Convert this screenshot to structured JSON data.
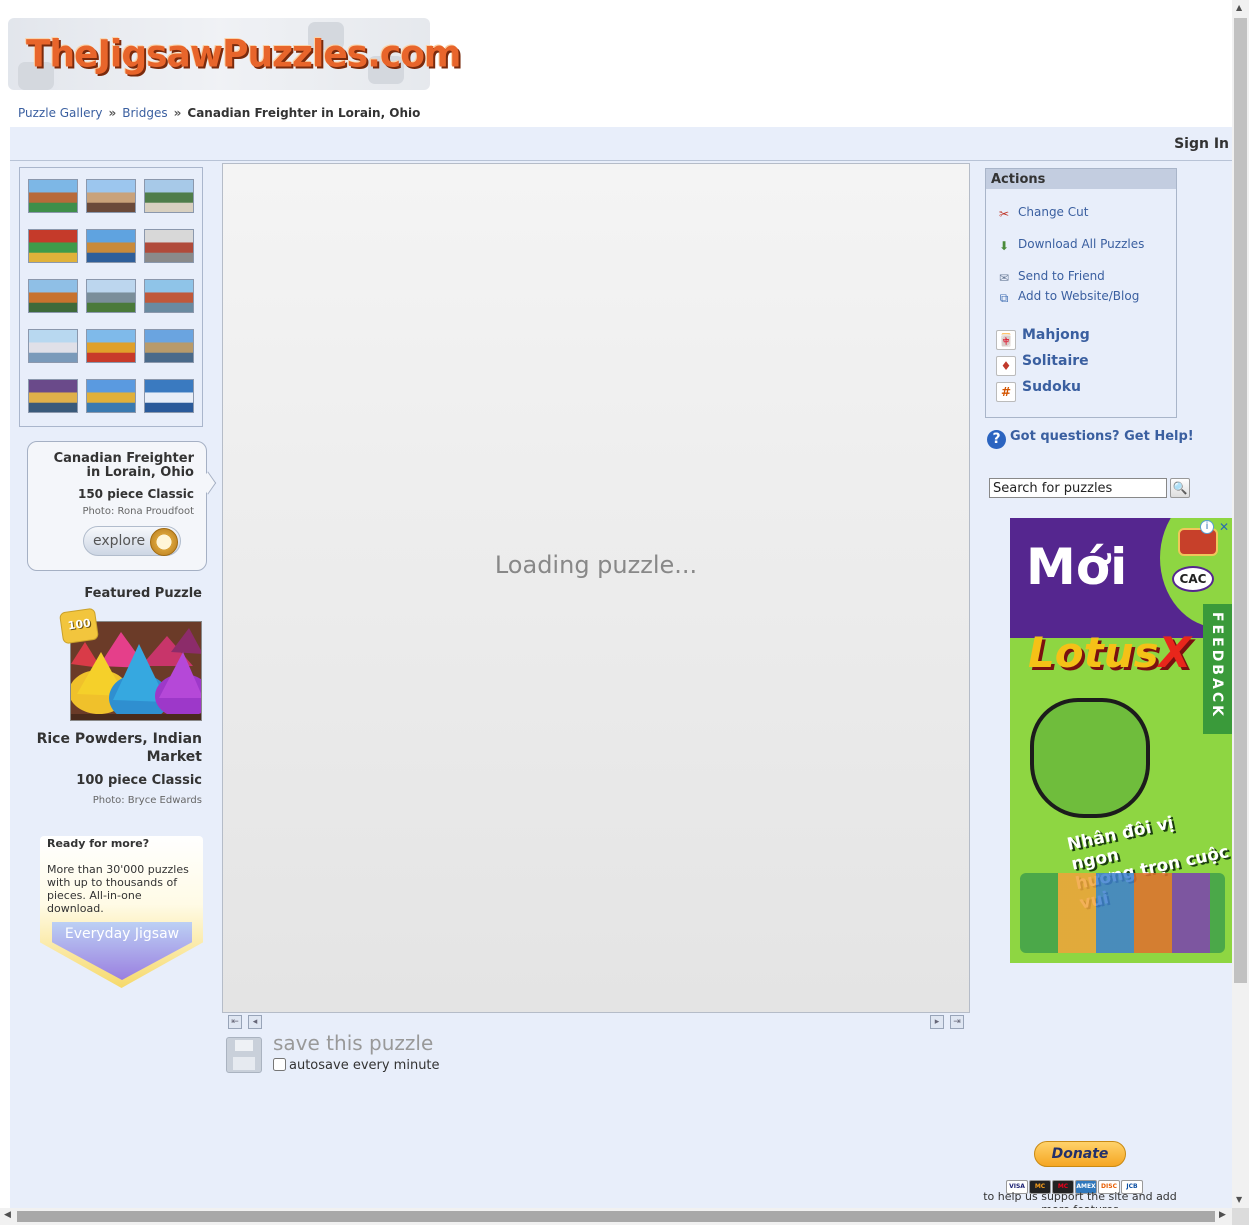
{
  "logo": {
    "text": "TheJigsawPuzzles.com"
  },
  "breadcrumb": {
    "items": [
      "Puzzle Gallery",
      "Bridges"
    ],
    "separator": "»",
    "current": "Canadian Freighter in Lorain, Ohio"
  },
  "header": {
    "sign_in": "Sign In"
  },
  "thumbnails": {
    "count": 15
  },
  "puzzle_info": {
    "title": "Canadian Freighter in Lorain, Ohio",
    "pieces": "150 piece Classic",
    "credit": "Photo: Rona Proudfoot",
    "explore_label": "explore"
  },
  "featured": {
    "heading": "Featured Puzzle",
    "badge": "100",
    "title": "Rice Powders, Indian Market",
    "pieces": "100 piece Classic",
    "credit": "Photo: Bryce Edwards"
  },
  "promo": {
    "heading": "Ready for more?",
    "body": "More than 30'000 puzzles with up to thousands of pieces. All-in-one download.",
    "button": "Everyday Jigsaw"
  },
  "puzzle_area": {
    "loading": "Loading puzzle...",
    "save_label": "save this puzzle",
    "autosave_label": "autosave every minute"
  },
  "actions": {
    "heading": "Actions",
    "items": [
      {
        "label": "Change Cut",
        "icon": "scissors-icon"
      },
      {
        "label": "Download All Puzzles",
        "icon": "download-icon"
      },
      {
        "label": "Send to Friend",
        "icon": "envelope-icon"
      },
      {
        "label": "Add to Website/Blog",
        "icon": "embed-icon"
      }
    ],
    "games": [
      {
        "label": "Mahjong",
        "icon": "mahjong-icon"
      },
      {
        "label": "Solitaire",
        "icon": "cards-icon"
      },
      {
        "label": "Sudoku",
        "icon": "sudoku-icon"
      }
    ]
  },
  "help": {
    "label": "Got questions? Get Help!"
  },
  "search": {
    "value": "Search for puzzles"
  },
  "ad": {
    "headline": "Mới",
    "brand": "Lotus",
    "brand_x": "X",
    "badge": "CAC",
    "slogan_line1": "Nhân đôi vị ngon",
    "slogan_line2": "hương trọn cuộc vui"
  },
  "feedback": {
    "label": "FEEDBACK"
  },
  "donate": {
    "button": "Donate",
    "cards": [
      "VISA",
      "MC",
      "MC",
      "AMEX",
      "DISC",
      "JCB"
    ],
    "text": "to help us support the site and add more features"
  },
  "colors": {
    "panel_bg": "#e8eefa",
    "link": "#3a5fa0",
    "logo_orange": "#e8652b",
    "ad_green": "#8ed642",
    "ad_purple": "#55268f"
  }
}
